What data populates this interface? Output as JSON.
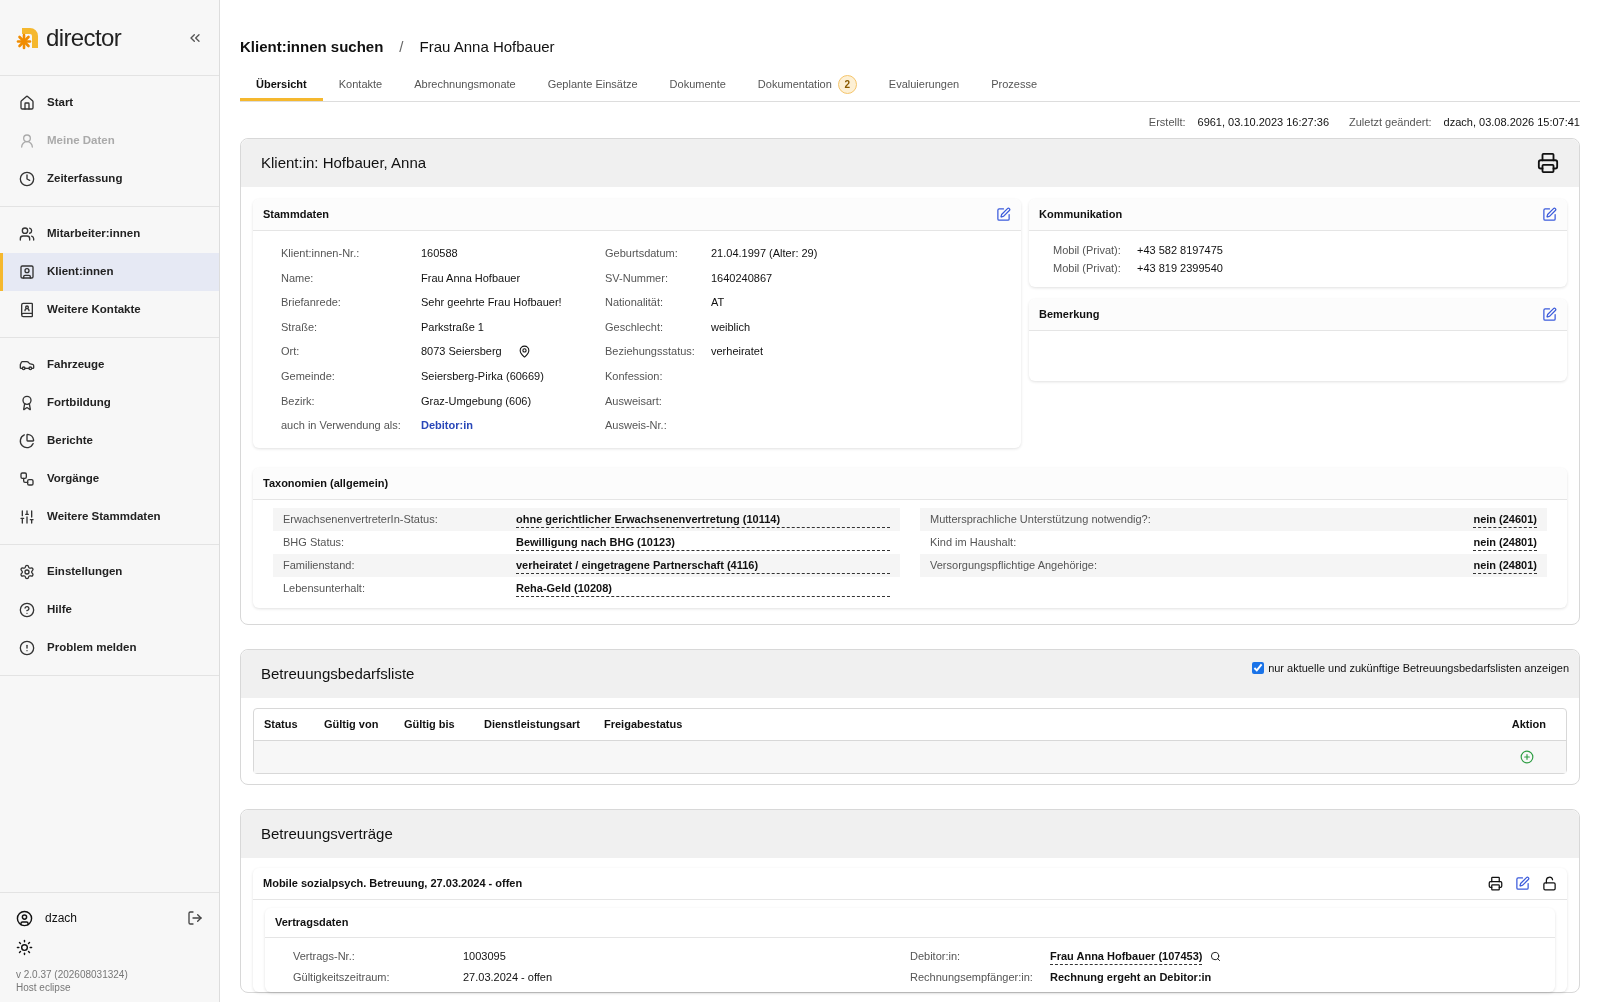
{
  "sidebar": {
    "logo_text": "director",
    "groups": [
      [
        {
          "label": "Start",
          "selected": false,
          "disabled": false
        },
        {
          "label": "Meine Daten",
          "selected": false,
          "disabled": true
        },
        {
          "label": "Zeiterfassung",
          "selected": false,
          "disabled": false
        }
      ],
      [
        {
          "label": "Mitarbeiter:innen",
          "selected": false,
          "disabled": false
        },
        {
          "label": "Klient:innen",
          "selected": true,
          "disabled": false
        },
        {
          "label": "Weitere Kontakte",
          "selected": false,
          "disabled": false
        }
      ],
      [
        {
          "label": "Fahrzeuge",
          "selected": false,
          "disabled": false
        },
        {
          "label": "Fortbildung",
          "selected": false,
          "disabled": false
        },
        {
          "label": "Berichte",
          "selected": false,
          "disabled": false
        },
        {
          "label": "Vorgänge",
          "selected": false,
          "disabled": false
        },
        {
          "label": "Weitere Stammdaten",
          "selected": false,
          "disabled": false
        }
      ],
      [
        {
          "label": "Einstellungen",
          "selected": false,
          "disabled": false
        },
        {
          "label": "Hilfe",
          "selected": false,
          "disabled": false
        },
        {
          "label": "Problem melden",
          "selected": false,
          "disabled": false
        }
      ]
    ],
    "user": "dzach",
    "version": "v 2.0.37 (202608031324)",
    "host": "Host eclipse"
  },
  "breadcrumb": {
    "items": [
      "Klient:innen suchen",
      "Frau Anna Hofbauer"
    ],
    "separator": "/"
  },
  "tabs": [
    {
      "label": "Übersicht",
      "selected": true
    },
    {
      "label": "Kontakte",
      "selected": false
    },
    {
      "label": "Abrechnungsmonate",
      "selected": false
    },
    {
      "label": "Geplante Einsätze",
      "selected": false
    },
    {
      "label": "Dokumente",
      "selected": false
    },
    {
      "label": "Dokumentation",
      "selected": false,
      "badge": "2"
    },
    {
      "label": "Evaluierungen",
      "selected": false
    },
    {
      "label": "Prozesse",
      "selected": false
    }
  ],
  "meta": [
    {
      "label": "Erstellt:",
      "value": "6961, 03.10.2023 16:27:36"
    },
    {
      "label": "Zuletzt geändert:",
      "value": "dzach, 03.08.2026 15:07:41"
    }
  ],
  "client_card": {
    "title": "Klient:in: Hofbauer, Anna",
    "stammdaten": {
      "title": "Stammdaten",
      "left": [
        {
          "label": "Klient:innen-Nr.:",
          "value": "160588"
        },
        {
          "label": "Name:",
          "value": "Frau Anna Hofbauer"
        },
        {
          "label": "Briefanrede:",
          "value": "Sehr geehrte Frau Hofbauer!"
        },
        {
          "label": "Straße:",
          "value": "Parkstraße 1"
        },
        {
          "label": "Ort:",
          "value": "8073 Seiersberg",
          "kind": "location"
        },
        {
          "label": "Gemeinde:",
          "value": "Seiersberg-Pirka (60669)"
        },
        {
          "label": "Bezirk:",
          "value": "Graz-Umgebung (606)"
        },
        {
          "label": "auch in Verwendung als:",
          "value": "Debitor:in",
          "kind": "link"
        }
      ],
      "right": [
        {
          "label": "Geburtsdatum:",
          "value": "21.04.1997 (Alter: 29)"
        },
        {
          "label": "SV-Nummer:",
          "value": "1640240867"
        },
        {
          "label": "Nationalität:",
          "value": "AT"
        },
        {
          "label": "Geschlecht:",
          "value": "weiblich"
        },
        {
          "label": "Beziehungsstatus:",
          "value": "verheiratet"
        },
        {
          "label": "Konfession:"
        },
        {
          "label": "Ausweisart:"
        },
        {
          "label": "Ausweis-Nr.:"
        }
      ]
    },
    "kommunikation": {
      "title": "Kommunikation",
      "rows": [
        {
          "label": "Mobil (Privat):",
          "value": "+43 582 8197475"
        },
        {
          "label": "Mobil (Privat):",
          "value": "+43 819 2399540"
        }
      ]
    },
    "bemerkung": {
      "title": "Bemerkung"
    },
    "taxonomien": {
      "title": "Taxonomien (allgemein)",
      "left": [
        {
          "label": "ErwachsenenvertreterIn-Status:",
          "value": "ohne gerichtlicher Erwachsenenvertretung (10114)"
        },
        {
          "label": "BHG Status:",
          "value": "Bewilligung nach BHG (10123)"
        },
        {
          "label": "Familienstand:",
          "value": "verheiratet / eingetragene Partnerschaft (4116)"
        },
        {
          "label": "Lebensunterhalt:",
          "value": "Reha-Geld (10208)"
        }
      ],
      "right": [
        {
          "label": "Muttersprachliche Unterstützung notwendig?:",
          "value": "nein (24601)"
        },
        {
          "label": "Kind im Haushalt:",
          "value": "nein (24801)"
        },
        {
          "label": "Versorgungspflichtige Angehörige:",
          "value": "nein (24801)"
        }
      ]
    }
  },
  "bedarfsliste": {
    "title": "Betreuungsbedarfsliste",
    "filter": {
      "label": "nur aktuelle und zukünftige Betreuungsbedarfslisten anzeigen",
      "checked": true
    },
    "columns": [
      "Status",
      "Gültig von",
      "Gültig bis",
      "Dienstleistungsart",
      "Freigabestatus",
      "Aktion"
    ]
  },
  "vertraege": {
    "title": "Betreuungsverträge",
    "contract": {
      "title": "Mobile sozialpsych. Betreuung, 27.03.2024 - offen",
      "section": "Vertragsdaten",
      "left": [
        {
          "label": "Vertrags-Nr.:",
          "value": "1003095"
        },
        {
          "label": "Gültigkeitszeitraum:",
          "value": "27.03.2024 - offen"
        }
      ],
      "right": [
        {
          "label": "Debitor:in:",
          "value": "Frau Anna Hofbauer (107453)",
          "kind": "lookup"
        },
        {
          "label": "Rechnungsempfänger:in:",
          "value": "Rechnung ergeht an Debitor:in",
          "kind": "bold"
        }
      ]
    }
  }
}
